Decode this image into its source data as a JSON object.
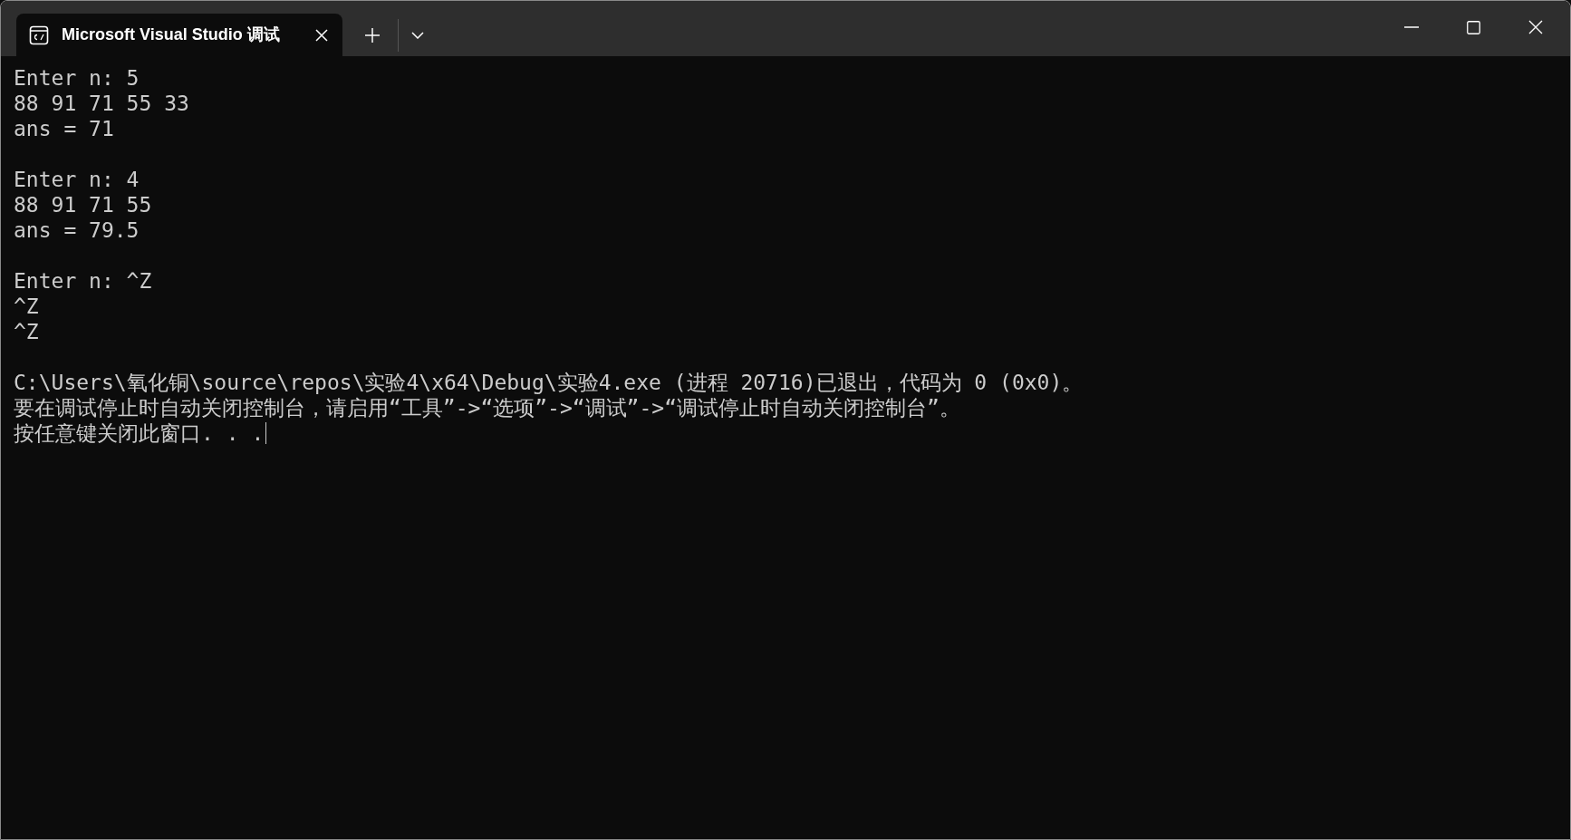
{
  "tab": {
    "title": "Microsoft Visual Studio 调试",
    "selected": true
  },
  "terminal": {
    "blocks": [
      [
        "Enter n: 5",
        "88 91 71 55 33",
        "ans = 71"
      ],
      [
        "Enter n: 4",
        "88 91 71 55",
        "ans = 79.5"
      ],
      [
        "Enter n: ^Z",
        "^Z",
        "^Z"
      ],
      [
        "C:\\Users\\氧化铜\\source\\repos\\实验4\\x64\\Debug\\实验4.exe (进程 20716)已退出，代码为 0 (0x0)。",
        "要在调试停止时自动关闭控制台，请启用“工具”->“选项”->“调试”->“调试停止时自动关闭控制台”。",
        "按任意键关闭此窗口. . ."
      ]
    ]
  }
}
